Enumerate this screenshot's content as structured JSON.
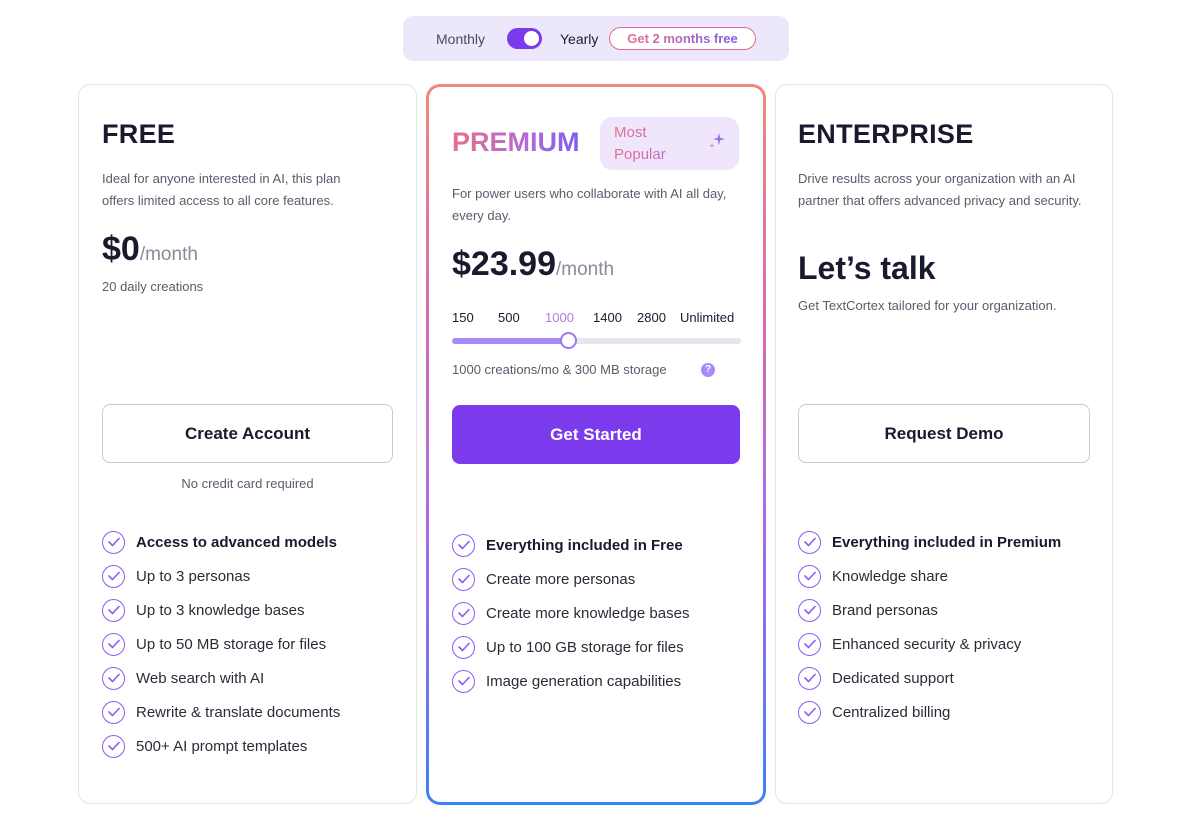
{
  "billing": {
    "monthly_label": "Monthly",
    "yearly_label": "Yearly",
    "promo": "Get 2 months free",
    "yearly_selected": true
  },
  "colors": {
    "accent": "#7c3aed",
    "check": "#8b5cf6",
    "slider_fill": "#a78bfa",
    "premium_gradient_start": "#e8708a",
    "premium_gradient_end": "#3b82f6"
  },
  "plans": {
    "free": {
      "title": "FREE",
      "description": "Ideal for anyone interested in AI, this plan offers limited access to all core features.",
      "price": "$0",
      "period": "/month",
      "note": "20 daily creations",
      "button": "Create Account",
      "button_note": "No credit card required",
      "features": [
        {
          "label": "Access to advanced models",
          "bold": true
        },
        {
          "label": "Up to 3 personas",
          "bold": false
        },
        {
          "label": "Up to 3 knowledge bases",
          "bold": false
        },
        {
          "label": "Up to 50 MB storage for files",
          "bold": false
        },
        {
          "label": "Web search with AI",
          "bold": false
        },
        {
          "label": "Rewrite & translate documents",
          "bold": false
        },
        {
          "label": "500+ AI prompt templates",
          "bold": false
        }
      ]
    },
    "premium": {
      "title": "PREMIUM",
      "badge": "Most Popular",
      "badge_icon": "sparkle-icon",
      "description": "For power users who collaborate with AI all day, every day.",
      "price": "$23.99",
      "period": "/month",
      "slider": {
        "options": [
          "150",
          "500",
          "1000",
          "1400",
          "2800",
          "Unlimited"
        ],
        "selected": "1000",
        "fill_fraction": 0.4
      },
      "storage_note": "1000 creations/mo & 300 MB storage",
      "help_icon": "?",
      "button": "Get Started",
      "features": [
        {
          "label": "Everything included in Free",
          "bold": true
        },
        {
          "label": "Create more personas",
          "bold": false
        },
        {
          "label": "Create more knowledge bases",
          "bold": false
        },
        {
          "label": "Up to 100 GB storage for files",
          "bold": false
        },
        {
          "label": "Image generation capabilities",
          "bold": false
        }
      ]
    },
    "enterprise": {
      "title": "ENTERPRISE",
      "description": "Drive results across your organization with an AI partner that offers advanced privacy and security.",
      "price": "Let’s talk",
      "note": "Get TextCortex tailored for your organization.",
      "button": "Request Demo",
      "features": [
        {
          "label": "Everything included in Premium",
          "bold": true
        },
        {
          "label": "Knowledge share",
          "bold": false
        },
        {
          "label": "Brand personas",
          "bold": false
        },
        {
          "label": "Enhanced security & privacy",
          "bold": false
        },
        {
          "label": "Dedicated support",
          "bold": false
        },
        {
          "label": "Centralized billing",
          "bold": false
        }
      ]
    }
  }
}
